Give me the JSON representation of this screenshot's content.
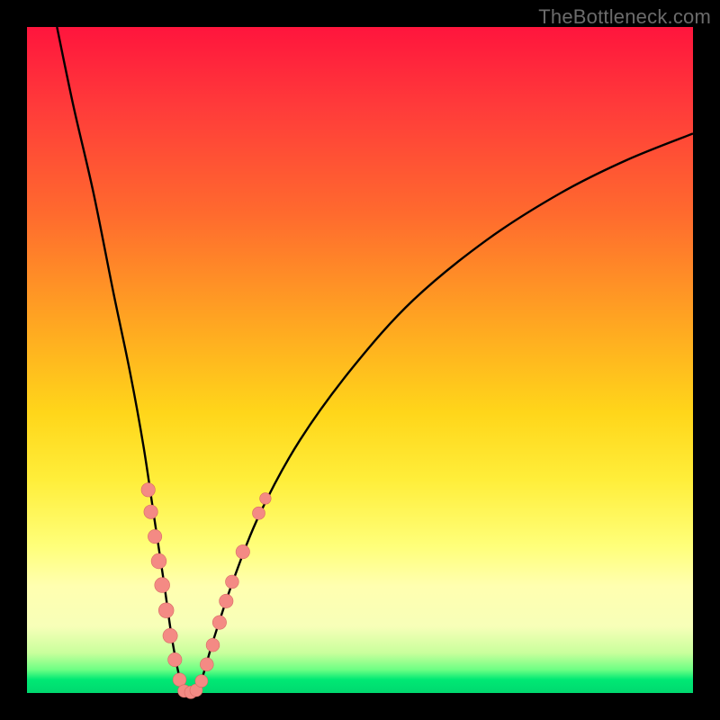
{
  "watermark": "TheBottleneck.com",
  "colors": {
    "frame": "#000000",
    "curve": "#000000",
    "marker_fill": "#f48a84",
    "marker_stroke": "#d86a64"
  },
  "chart_data": {
    "type": "line",
    "title": "",
    "xlabel": "",
    "ylabel": "",
    "xlim": [
      0,
      100
    ],
    "ylim": [
      0,
      100
    ],
    "grid": false,
    "curve": {
      "description": "V-shaped bottleneck curve; minimum near x≈24, rising steeply toward both edges",
      "points": [
        {
          "x": 4.5,
          "y": 100
        },
        {
          "x": 7,
          "y": 88
        },
        {
          "x": 10,
          "y": 75
        },
        {
          "x": 13,
          "y": 60
        },
        {
          "x": 15.5,
          "y": 48
        },
        {
          "x": 17.5,
          "y": 37
        },
        {
          "x": 19,
          "y": 27
        },
        {
          "x": 20.5,
          "y": 17
        },
        {
          "x": 21.8,
          "y": 8
        },
        {
          "x": 23,
          "y": 2
        },
        {
          "x": 24,
          "y": 0
        },
        {
          "x": 25,
          "y": 0
        },
        {
          "x": 26.2,
          "y": 2
        },
        {
          "x": 28,
          "y": 8
        },
        {
          "x": 31,
          "y": 17
        },
        {
          "x": 35,
          "y": 27
        },
        {
          "x": 41,
          "y": 38
        },
        {
          "x": 49,
          "y": 49
        },
        {
          "x": 58,
          "y": 59
        },
        {
          "x": 69,
          "y": 68
        },
        {
          "x": 80,
          "y": 75
        },
        {
          "x": 90,
          "y": 80
        },
        {
          "x": 100,
          "y": 84
        }
      ]
    },
    "markers": {
      "description": "salmon round markers clustered around the curve minimum",
      "points": [
        {
          "x": 18.2,
          "y": 30.5,
          "r": 1.1
        },
        {
          "x": 18.6,
          "y": 27.2,
          "r": 1.1
        },
        {
          "x": 19.2,
          "y": 23.5,
          "r": 1.1
        },
        {
          "x": 19.8,
          "y": 19.8,
          "r": 1.2
        },
        {
          "x": 20.3,
          "y": 16.2,
          "r": 1.2
        },
        {
          "x": 20.9,
          "y": 12.4,
          "r": 1.2
        },
        {
          "x": 21.5,
          "y": 8.6,
          "r": 1.15
        },
        {
          "x": 22.2,
          "y": 5.0,
          "r": 1.1
        },
        {
          "x": 22.9,
          "y": 2.0,
          "r": 1.05
        },
        {
          "x": 23.6,
          "y": 0.3,
          "r": 1.0
        },
        {
          "x": 24.6,
          "y": 0.1,
          "r": 1.0
        },
        {
          "x": 25.4,
          "y": 0.4,
          "r": 1.0
        },
        {
          "x": 26.2,
          "y": 1.8,
          "r": 1.0
        },
        {
          "x": 27.0,
          "y": 4.3,
          "r": 1.05
        },
        {
          "x": 27.9,
          "y": 7.2,
          "r": 1.05
        },
        {
          "x": 28.9,
          "y": 10.6,
          "r": 1.1
        },
        {
          "x": 29.9,
          "y": 13.8,
          "r": 1.1
        },
        {
          "x": 30.8,
          "y": 16.7,
          "r": 1.05
        },
        {
          "x": 32.4,
          "y": 21.2,
          "r": 1.1
        },
        {
          "x": 34.8,
          "y": 27.0,
          "r": 1.0
        },
        {
          "x": 35.8,
          "y": 29.2,
          "r": 0.9
        }
      ]
    }
  }
}
